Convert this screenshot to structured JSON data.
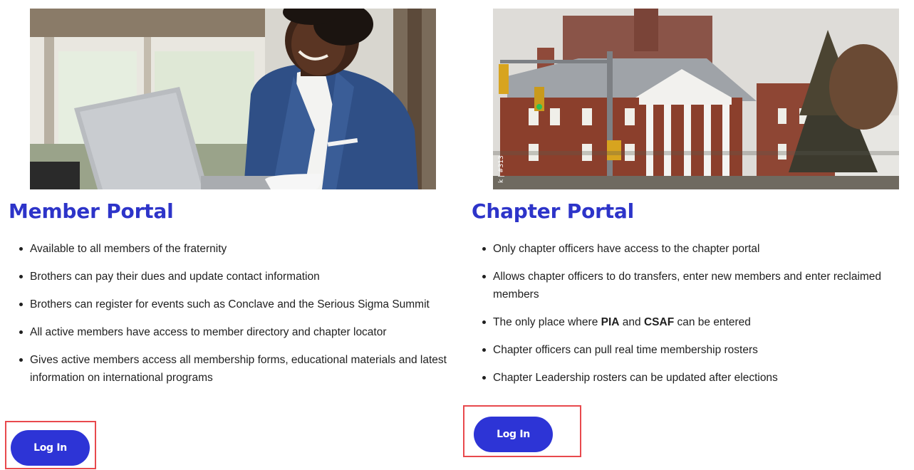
{
  "member_portal": {
    "title": "Member Portal",
    "features": [
      "Available to all members of the fraternity",
      "Brothers can pay their dues and update contact information",
      "Brothers can register for events such as Conclave and the Serious Sigma Summit",
      "All active members have access to member directory and chapter locator",
      "Gives active members access all membership forms, educational materials and latest information on international programs"
    ],
    "login_label": "Log In"
  },
  "chapter_portal": {
    "title": "Chapter Portal",
    "features": {
      "f1": "Only chapter officers have access to the chapter portal",
      "f2": "Allows chapter officers to do transfers, enter new members and enter reclaimed members",
      "f3_pre": "The only place where ",
      "f3_bold1": "PIA",
      "f3_mid": " and ",
      "f3_bold2": "CSAF",
      "f3_post": " can be entered",
      "f4": "Chapter officers can pull real time membership rosters",
      "f5": "Chapter Leadership rosters can be updated after elections"
    },
    "login_label": "Log In",
    "photo_watermark": "k | #313"
  },
  "colors": {
    "title": "#2d34c9",
    "button": "#2d34d6",
    "highlight_frame": "#e8494d"
  }
}
